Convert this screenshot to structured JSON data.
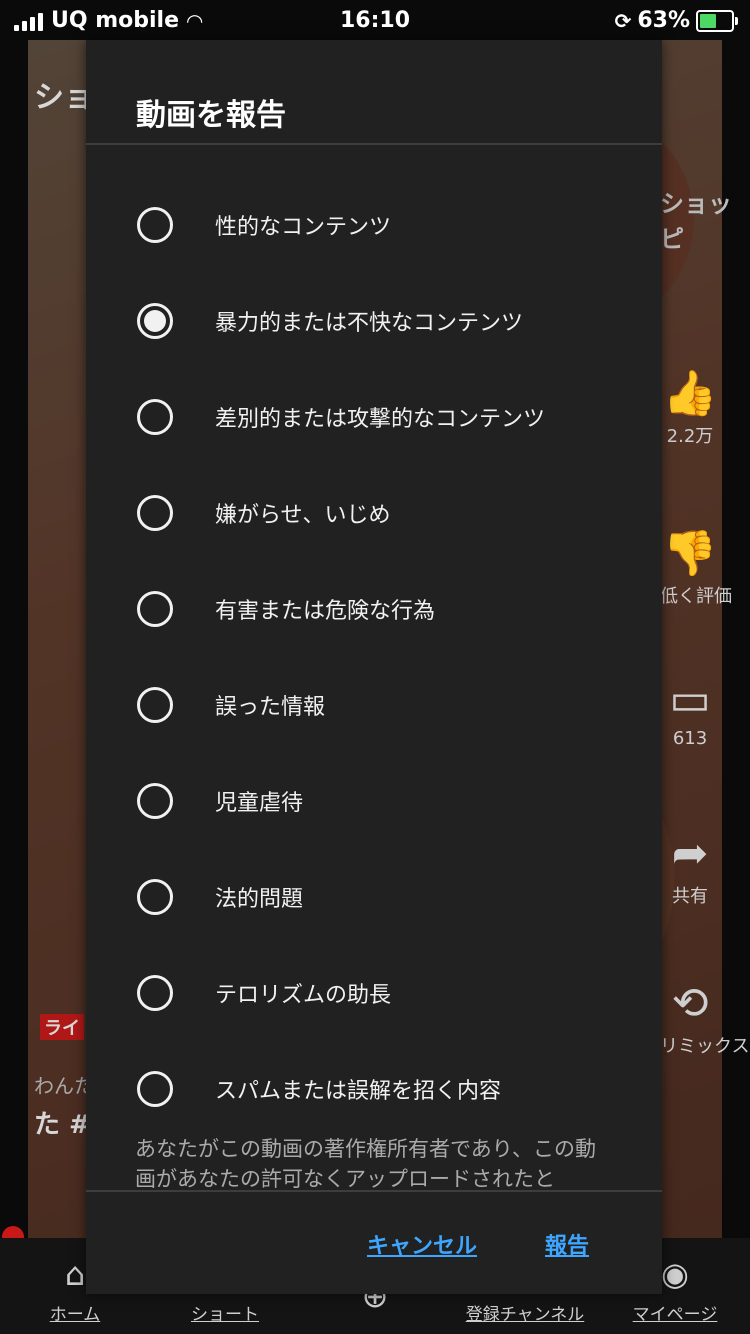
{
  "status_bar": {
    "carrier": "UQ mobile",
    "time": "16:10",
    "battery_percent": "63%",
    "battery_level": 0.63
  },
  "background": {
    "header_text": "ショ",
    "shopping_tag": "ショッピ",
    "channel_label": "ライ",
    "caption_line1": "わんた",
    "caption_line2": "た #",
    "actions": [
      {
        "icon": "thumbs-up-icon",
        "label": "2.2万"
      },
      {
        "icon": "thumbs-down-icon",
        "label": "低く評価"
      },
      {
        "icon": "comment-icon",
        "label": "613"
      },
      {
        "icon": "share-icon",
        "label": "共有"
      },
      {
        "icon": "remix-icon",
        "label": "リミックス"
      }
    ]
  },
  "bottom_nav": {
    "items": [
      {
        "icon": "home-icon",
        "label": "ホーム"
      },
      {
        "icon": "shorts-icon",
        "label": "ショート"
      },
      {
        "icon": "add-icon",
        "label": ""
      },
      {
        "icon": "subscriptions-icon",
        "label": "登録チャンネル"
      },
      {
        "icon": "avatar-icon",
        "label": "マイページ"
      }
    ]
  },
  "dialog": {
    "title": "動画を報告",
    "selected_index": 1,
    "options": [
      "性的なコンテンツ",
      "暴力的または不快なコンテンツ",
      "差別的または攻撃的なコンテンツ",
      "嫌がらせ、いじめ",
      "有害または危険な行為",
      "誤った情報",
      "児童虐待",
      "法的問題",
      "テロリズムの助長",
      "スパムまたは誤解を招く内容"
    ],
    "disclaimer": "あなたがこの動画の著作権所有者であり、この動画があなたの許可なくアップロードされたと",
    "cancel_label": "キャンセル",
    "submit_label": "報告"
  }
}
